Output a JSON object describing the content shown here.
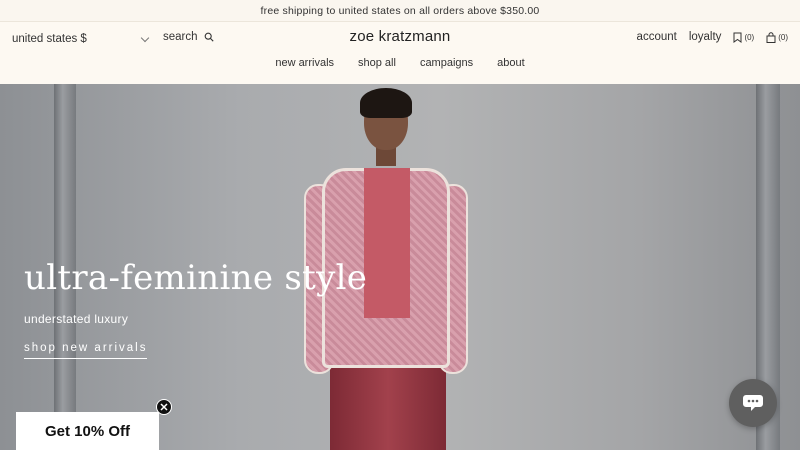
{
  "announcement": {
    "text": "free shipping to united states on all orders above $350.00"
  },
  "header": {
    "locale": "united states $",
    "search_label": "search",
    "logo": "zoe kratzmann",
    "account_label": "account",
    "loyalty_label": "loyalty",
    "wishlist_count": "(0)",
    "cart_count": "(0)"
  },
  "nav": [
    {
      "label": "new arrivals"
    },
    {
      "label": "shop all"
    },
    {
      "label": "campaigns"
    },
    {
      "label": "about"
    }
  ],
  "hero": {
    "title": "ultra-feminine style",
    "subtitle": "understated luxury",
    "cta": "shop new arrivals"
  },
  "promo": {
    "label": "Get 10% Off"
  },
  "icons": {
    "search": "search-icon",
    "wishlist": "bookmark-icon",
    "cart": "bag-icon",
    "close": "close-icon",
    "chat": "chat-icon",
    "locale_toggle": "chevron-down-icon"
  },
  "colors": {
    "background": "#faf6ef",
    "hero_text": "#ffffff",
    "promo_bg": "#ffffff",
    "chat_bg": "#5f5f5f"
  }
}
